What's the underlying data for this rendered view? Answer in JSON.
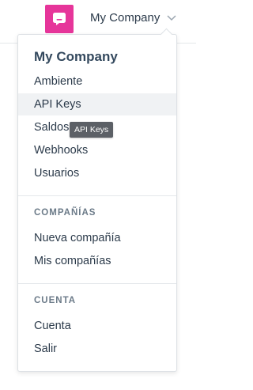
{
  "header": {
    "company_name": "My Company",
    "brand_color": "#e6359a",
    "logo_icon": "chat-icon",
    "chevron_icon": "chevron-down-icon"
  },
  "dropdown": {
    "title": "My Company",
    "items": [
      {
        "label": "Ambiente"
      },
      {
        "label": "API Keys"
      },
      {
        "label": "Saldos"
      },
      {
        "label": "Webhooks"
      },
      {
        "label": "Usuarios"
      }
    ],
    "sections": [
      {
        "label": "COMPAÑÍAS",
        "items": [
          {
            "label": "Nueva compañía"
          },
          {
            "label": "Mis compañías"
          }
        ]
      },
      {
        "label": "CUENTA",
        "items": [
          {
            "label": "Cuenta"
          },
          {
            "label": "Salir"
          }
        ]
      }
    ]
  },
  "tooltip": {
    "text": "API Keys"
  }
}
